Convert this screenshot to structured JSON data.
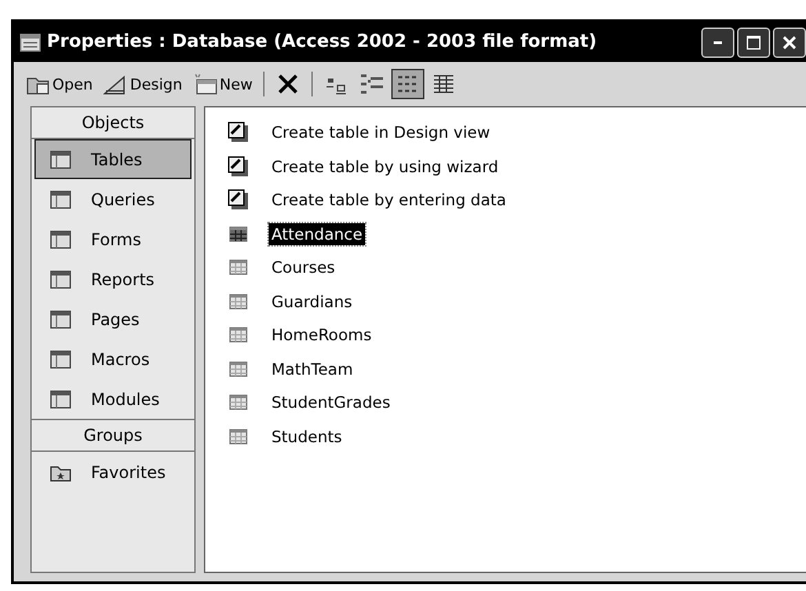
{
  "window": {
    "title": "Properties : Database (Access 2002 - 2003 file format)"
  },
  "toolbar": [
    {
      "kind": "labeled",
      "label": "Open",
      "selected": false
    },
    {
      "kind": "labeled",
      "label": "Design",
      "selected": false
    },
    {
      "kind": "labeled",
      "label": "New",
      "selected": false
    },
    {
      "kind": "separator"
    },
    {
      "kind": "icon",
      "selected": false
    },
    {
      "kind": "separator"
    },
    {
      "kind": "icon",
      "selected": false
    },
    {
      "kind": "icon",
      "selected": false
    },
    {
      "kind": "icon",
      "selected": true
    },
    {
      "kind": "icon",
      "selected": false
    }
  ],
  "sidebar": {
    "objects_header": "Objects",
    "items": [
      {
        "label": "Tables",
        "selected": true
      },
      {
        "label": "Queries",
        "selected": false
      },
      {
        "label": "Forms",
        "selected": false
      },
      {
        "label": "Reports",
        "selected": false
      },
      {
        "label": "Pages",
        "selected": false
      },
      {
        "label": "Macros",
        "selected": false
      },
      {
        "label": "Modules",
        "selected": false
      }
    ],
    "groups_header": "Groups",
    "groups": [
      {
        "label": "Favorites",
        "selected": false
      }
    ]
  },
  "list": [
    {
      "kind": "shortcut",
      "label": "Create table in Design view",
      "selected": false
    },
    {
      "kind": "shortcut",
      "label": "Create table by using wizard",
      "selected": false
    },
    {
      "kind": "shortcut",
      "label": "Create table by entering data",
      "selected": false
    },
    {
      "kind": "table",
      "label": "Attendance",
      "selected": true
    },
    {
      "kind": "table",
      "label": "Courses",
      "selected": false
    },
    {
      "kind": "table",
      "label": "Guardians",
      "selected": false
    },
    {
      "kind": "table",
      "label": "HomeRooms",
      "selected": false
    },
    {
      "kind": "table",
      "label": "MathTeam",
      "selected": false
    },
    {
      "kind": "table",
      "label": "StudentGrades",
      "selected": false
    },
    {
      "kind": "table",
      "label": "Students",
      "selected": false
    }
  ]
}
